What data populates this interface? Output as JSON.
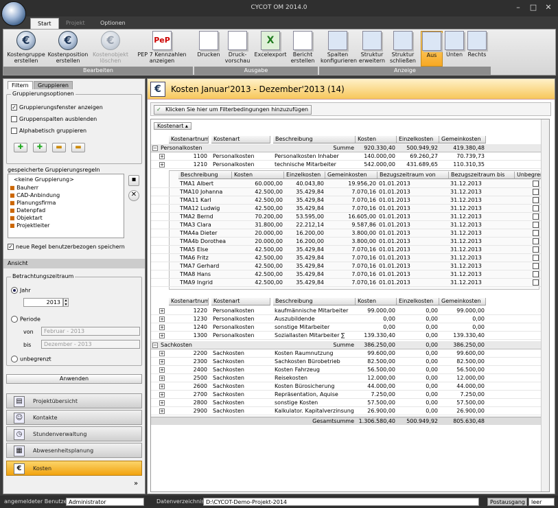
{
  "app": {
    "title": "CYCOT OM 2014.0",
    "minimize": "–",
    "maximize": "□",
    "close": "✕"
  },
  "ribbon": {
    "tabs": [
      "Start",
      "Projekt",
      "Optionen"
    ],
    "buttons": [
      {
        "label": "Kostengruppe erstellen"
      },
      {
        "label": "Kostenposition erstellen"
      },
      {
        "label": "Kostenobjekt löschen"
      },
      {
        "label": "PEP 7 Kennzahlen anzeigen"
      },
      {
        "label": "Drucken"
      },
      {
        "label": "Druck-vorschau"
      },
      {
        "label": "Excelexport"
      },
      {
        "label": "Bericht erstellen"
      },
      {
        "label": "Spalten konfigurieren"
      },
      {
        "label": "Struktur erweitern"
      },
      {
        "label": "Struktur schließen"
      },
      {
        "label": "Aus"
      },
      {
        "label": "Unten"
      },
      {
        "label": "Rechts"
      }
    ],
    "groups": [
      "Bearbeiten",
      "Ausgabe",
      "Anzeige"
    ]
  },
  "left": {
    "tabs": [
      "Filtern",
      "Gruppieren"
    ],
    "grouping_title": "Gruppierungsoptionen",
    "options": [
      {
        "label": "Gruppierungsfenster anzeigen",
        "checked": true
      },
      {
        "label": "Gruppenspalten ausblenden",
        "checked": false
      },
      {
        "label": "Alphabetisch gruppieren",
        "checked": false
      }
    ],
    "saved_rules_label": "gespeicherte Gruppierungsregeln",
    "rules": [
      "<keine Gruppierung>",
      "Bauherr",
      "CAD-Anbindung",
      "Planungsfirma",
      "Datenpfad",
      "Objektart",
      "Projektleiter"
    ],
    "save_rule_label": "neue Regel benutzerbezogen speichern",
    "view_title": "Ansicht",
    "period_title": "Betrachtungszeitraum",
    "year_label": "Jahr",
    "year_value": "2013",
    "period_label": "Periode",
    "from_label": "von",
    "from_value": "Februar  - 2013",
    "to_label": "bis",
    "to_value": "Dezember - 2013",
    "unlimited_label": "unbegrenzt",
    "apply_label": "Anwenden",
    "nav": [
      "Projektübersicht",
      "Kontakte",
      "Stundenverwaltung",
      "Abwesenheitsplanung",
      "Kosten"
    ]
  },
  "main": {
    "title": "Kosten Januar'2013 - Dezember'2013 (14)",
    "filter_button": "Klicken Sie hier um Filterbedingungen hinzuzufügen",
    "group_chip": "Kostenart",
    "columns": [
      "Kostenartnumme",
      "Kostenart",
      "Beschreibung",
      "Kosten",
      "Einzelkosten",
      "Gemeinkosten"
    ],
    "groups": [
      {
        "name": "Personalkosten",
        "sum_label": "Summe",
        "kosten": "920.330,40",
        "einzel": "500.949,92",
        "gemein": "419.380,48",
        "rows_before": [
          {
            "nr": "1100",
            "art": "Personalkosten",
            "desc": "Personalkosten Inhaber",
            "kosten": "140.000,00",
            "einzel": "69.260,27",
            "gemein": "70.739,73"
          },
          {
            "nr": "1210",
            "art": "Personalkosten",
            "desc": "technische Mitarbeiter",
            "kosten": "542.000,00",
            "einzel": "431.689,65",
            "gemein": "110.310,35"
          }
        ],
        "rows_after": [
          {
            "nr": "1220",
            "art": "Personalkosten",
            "desc": "kaufmännische Mitarbeiter",
            "kosten": "99.000,00",
            "einzel": "0,00",
            "gemein": "99.000,00"
          },
          {
            "nr": "1230",
            "art": "Personalkosten",
            "desc": "Auszubildende",
            "kosten": "0,00",
            "einzel": "0,00",
            "gemein": "0,00"
          },
          {
            "nr": "1240",
            "art": "Personalkosten",
            "desc": "sonstige Mitarbeiter",
            "kosten": "0,00",
            "einzel": "0,00",
            "gemein": "0,00"
          },
          {
            "nr": "1300",
            "art": "Personalkosten",
            "desc": "Soziallasten Mitarbeiter ∑",
            "kosten": "139.330,40",
            "einzel": "0,00",
            "gemein": "139.330,40"
          }
        ]
      },
      {
        "name": "Sachkosten",
        "sum_label": "Summe",
        "kosten": "386.250,00",
        "einzel": "0,00",
        "gemein": "386.250,00",
        "rows": [
          {
            "nr": "2200",
            "art": "Sachkosten",
            "desc": "Kosten Raumnutzung",
            "kosten": "99.600,00",
            "einzel": "0,00",
            "gemein": "99.600,00"
          },
          {
            "nr": "2300",
            "art": "Sachkosten",
            "desc": "Sachkosten Bürobetrieb",
            "kosten": "82.500,00",
            "einzel": "0,00",
            "gemein": "82.500,00"
          },
          {
            "nr": "2400",
            "art": "Sachkosten",
            "desc": "Kosten Fahrzeug",
            "kosten": "56.500,00",
            "einzel": "0,00",
            "gemein": "56.500,00"
          },
          {
            "nr": "2500",
            "art": "Sachkosten",
            "desc": "Reisekosten",
            "kosten": "12.000,00",
            "einzel": "0,00",
            "gemein": "12.000,00"
          },
          {
            "nr": "2600",
            "art": "Sachkosten",
            "desc": "Kosten Bürosicherung",
            "kosten": "44.000,00",
            "einzel": "0,00",
            "gemein": "44.000,00"
          },
          {
            "nr": "2700",
            "art": "Sachkosten",
            "desc": "Repräsentation, Aquise",
            "kosten": "7.250,00",
            "einzel": "0,00",
            "gemein": "7.250,00"
          },
          {
            "nr": "2800",
            "art": "Sachkosten",
            "desc": "sonstige Kosten",
            "kosten": "57.500,00",
            "einzel": "0,00",
            "gemein": "57.500,00"
          },
          {
            "nr": "2900",
            "art": "Sachkosten",
            "desc": "Kalkulator. Kapitalverzinsung",
            "kosten": "26.900,00",
            "einzel": "0,00",
            "gemein": "26.900,00"
          }
        ]
      }
    ],
    "detail_columns": [
      "Beschreibung",
      "Kosten",
      "Einzelkosten",
      "Gemeinkosten",
      "Bezugszeitraum von",
      "Bezugszeitraum bis",
      "Unbegrenzt"
    ],
    "detail_rows": [
      {
        "name": "TMA1 Albert",
        "kosten": "60.000,00",
        "einzel": "40.043,80",
        "gemein": "19.956,20",
        "von": "01.01.2013",
        "bis": "31.12.2013"
      },
      {
        "name": "TMA10 Johanna",
        "kosten": "42.500,00",
        "einzel": "35.429,84",
        "gemein": "7.070,16",
        "von": "01.01.2013",
        "bis": "31.12.2013"
      },
      {
        "name": "TMA11 Karl",
        "kosten": "42.500,00",
        "einzel": "35.429,84",
        "gemein": "7.070,16",
        "von": "01.01.2013",
        "bis": "31.12.2013"
      },
      {
        "name": "TMA12 Ludwig",
        "kosten": "42.500,00",
        "einzel": "35.429,84",
        "gemein": "7.070,16",
        "von": "01.01.2013",
        "bis": "31.12.2013"
      },
      {
        "name": "TMA2 Bernd",
        "kosten": "70.200,00",
        "einzel": "53.595,00",
        "gemein": "16.605,00",
        "von": "01.01.2013",
        "bis": "31.12.2013"
      },
      {
        "name": "TMA3 Clara",
        "kosten": "31.800,00",
        "einzel": "22.212,14",
        "gemein": "9.587,86",
        "von": "01.01.2013",
        "bis": "31.12.2013"
      },
      {
        "name": "TMA4a Dieter",
        "kosten": "20.000,00",
        "einzel": "16.200,00",
        "gemein": "3.800,00",
        "von": "01.01.2013",
        "bis": "31.12.2013"
      },
      {
        "name": "TMA4b Dorothea",
        "kosten": "20.000,00",
        "einzel": "16.200,00",
        "gemein": "3.800,00",
        "von": "01.01.2013",
        "bis": "31.12.2013"
      },
      {
        "name": "TMA5 Else",
        "kosten": "42.500,00",
        "einzel": "35.429,84",
        "gemein": "7.070,16",
        "von": "01.01.2013",
        "bis": "31.12.2013"
      },
      {
        "name": "TMA6 Fritz",
        "kosten": "42.500,00",
        "einzel": "35.429,84",
        "gemein": "7.070,16",
        "von": "01.01.2013",
        "bis": "31.12.2013"
      },
      {
        "name": "TMA7 Gerhard",
        "kosten": "42.500,00",
        "einzel": "35.429,84",
        "gemein": "7.070,16",
        "von": "01.01.2013",
        "bis": "31.12.2013"
      },
      {
        "name": "TMA8 Hans",
        "kosten": "42.500,00",
        "einzel": "35.429,84",
        "gemein": "7.070,16",
        "von": "01.01.2013",
        "bis": "31.12.2013"
      },
      {
        "name": "TMA9 Ingrid",
        "kosten": "42.500,00",
        "einzel": "35.429,84",
        "gemein": "7.070,16",
        "von": "01.01.2013",
        "bis": "31.12.2013"
      }
    ],
    "total": {
      "label": "Gesamtsumme",
      "kosten": "1.306.580,40",
      "einzel": "500.949,92",
      "gemein": "805.630,48"
    }
  },
  "status": {
    "user_label": "angemeldeter Benutzer",
    "user_value": "Administrator",
    "dir_label": "Datenverzeichnis",
    "dir_value": "D:\\CYCOT-Demo-Projekt-2014",
    "outbox_label": "Postausgang",
    "outbox_value": "leer"
  }
}
